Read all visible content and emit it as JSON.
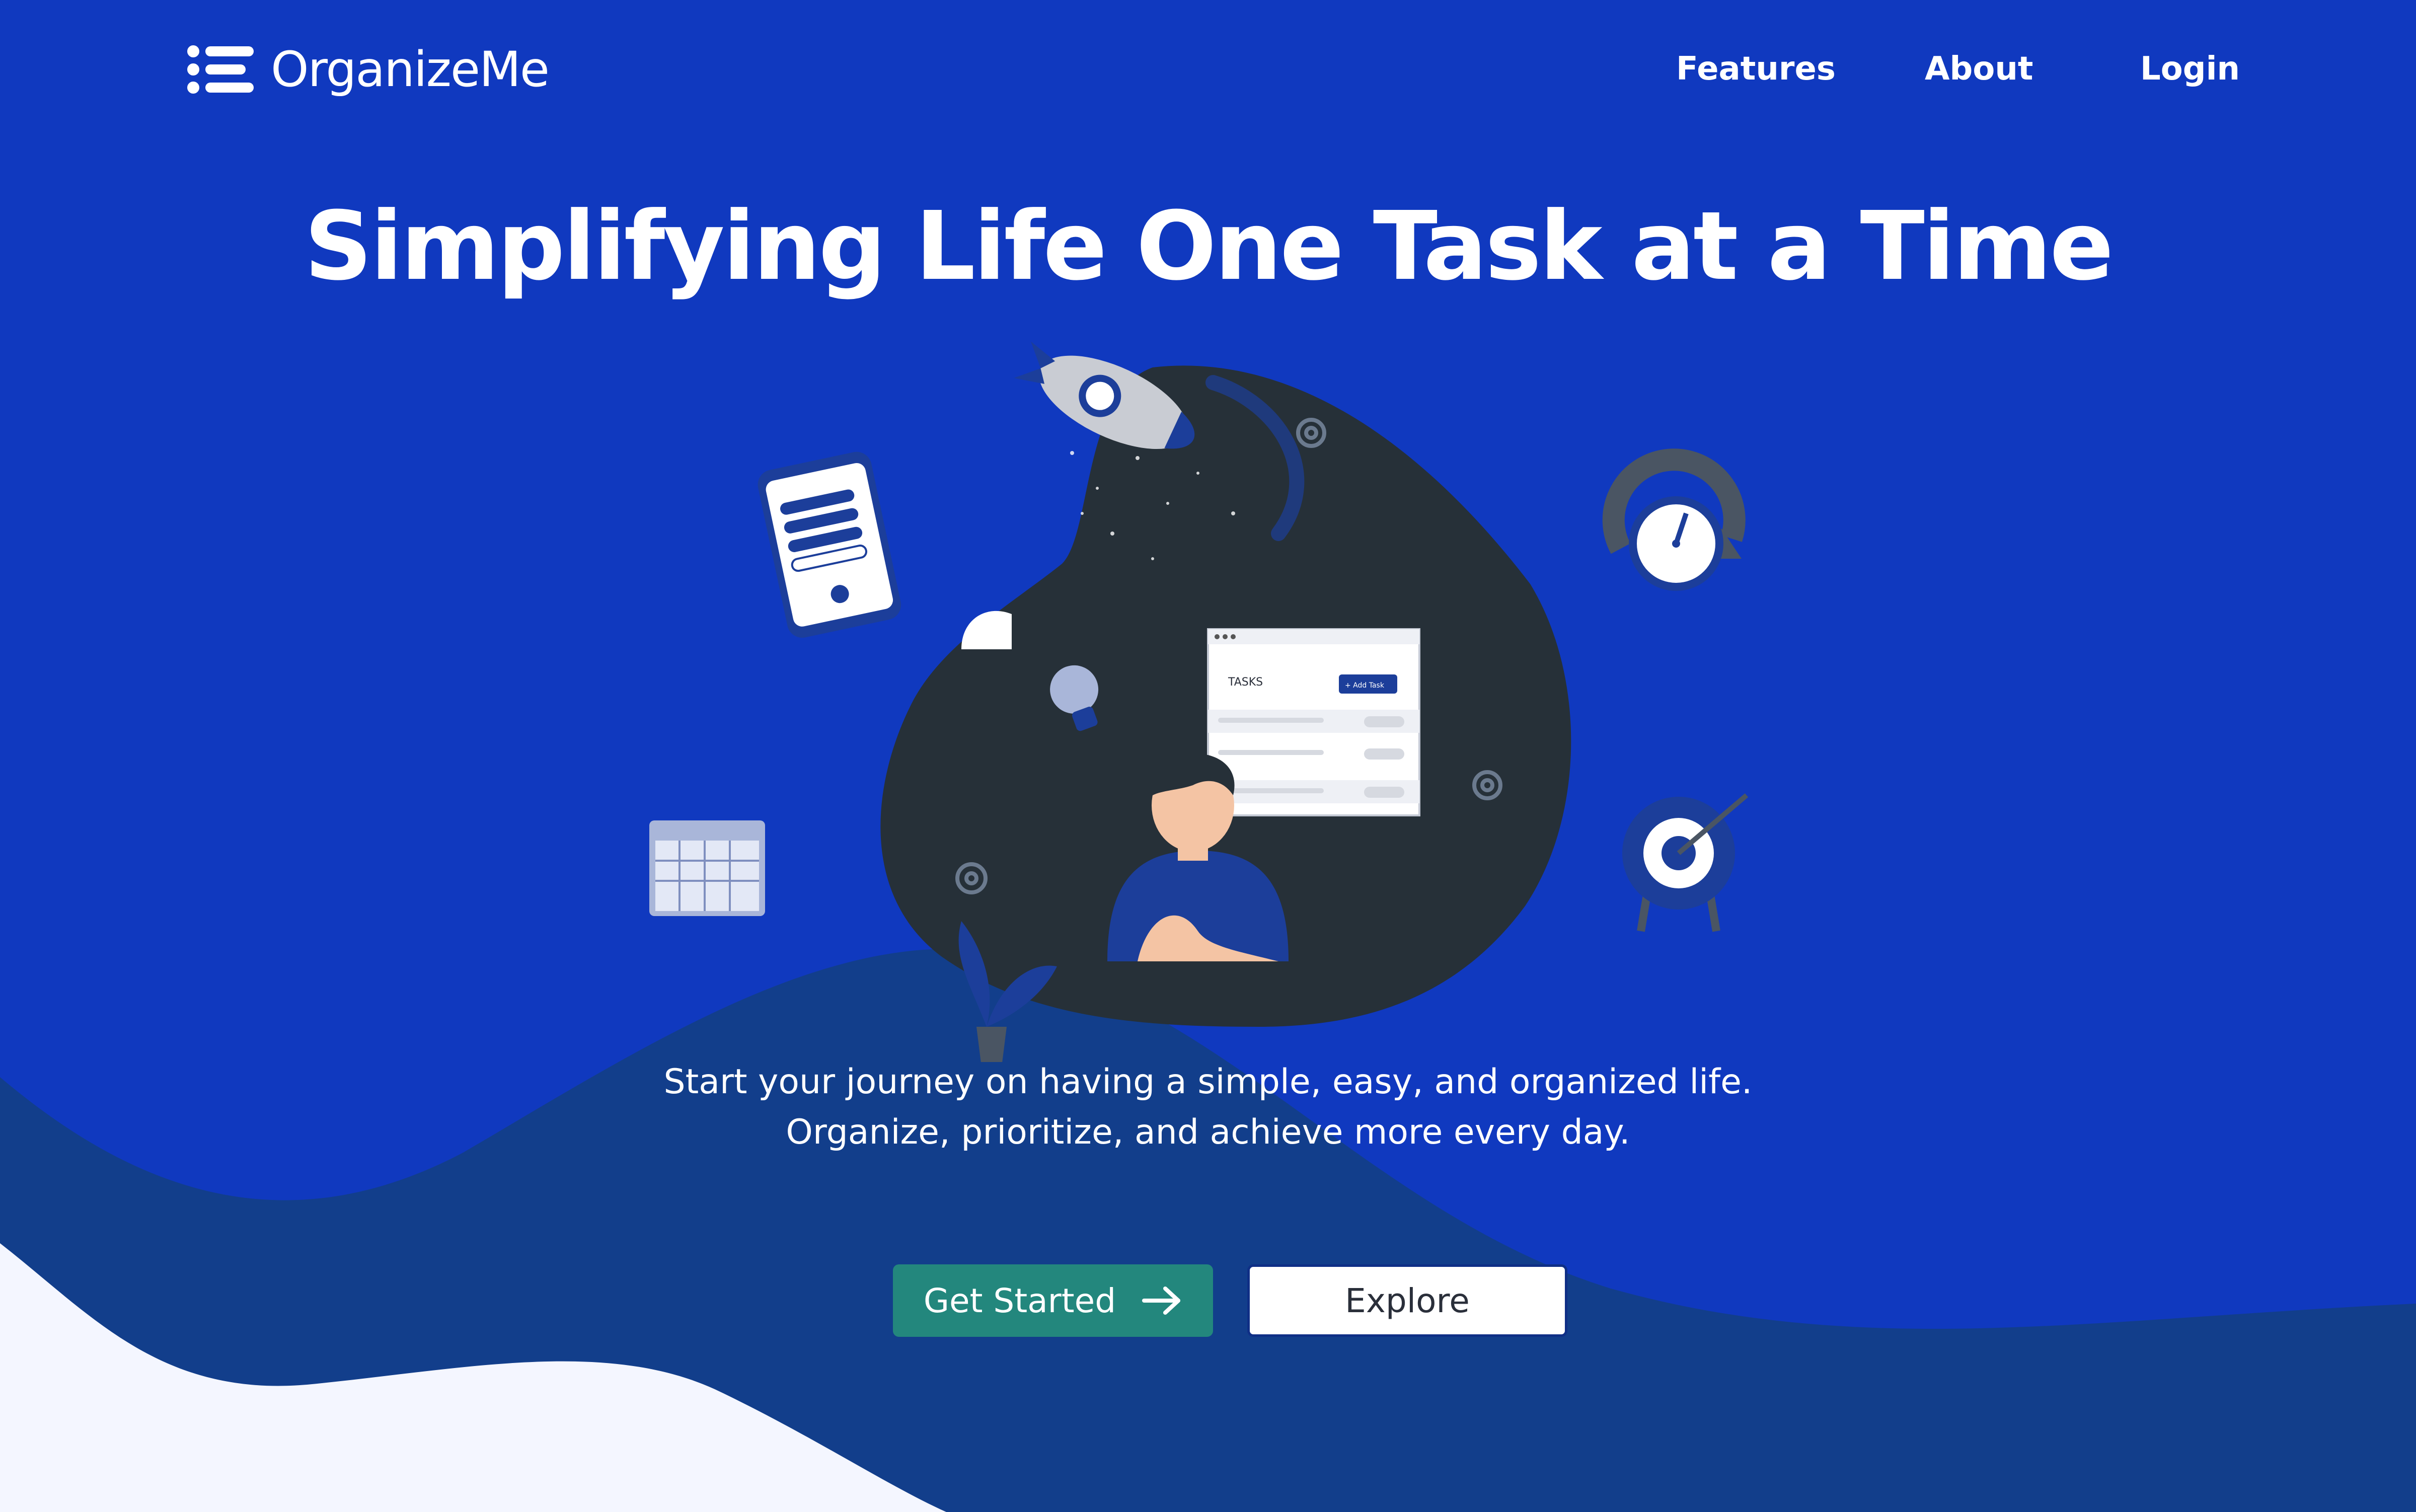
{
  "brand": {
    "name": "OrganizeMe",
    "icon": "list-menu-icon"
  },
  "nav": {
    "features": "Features",
    "about": "About",
    "login": "Login"
  },
  "hero": {
    "headline": "Simplifying Life One Task at a Time",
    "subtitle_line1": "Start your journey on having a simple, easy, and organized life.",
    "subtitle_line2": "Organize, prioritize, and achieve more every day."
  },
  "buttons": {
    "get_started": "Get Started",
    "get_started_icon": "arrow-right-icon",
    "explore": "Explore"
  },
  "illustration": {
    "tasks_card_title": "TASKS",
    "tasks_card_button": "+ Add Task"
  },
  "colors": {
    "background": "#1039bf",
    "wave_dark": "#123e8b",
    "wave_light": "#f4f6ff",
    "primary_button": "#23877d",
    "blob": "#263038"
  }
}
